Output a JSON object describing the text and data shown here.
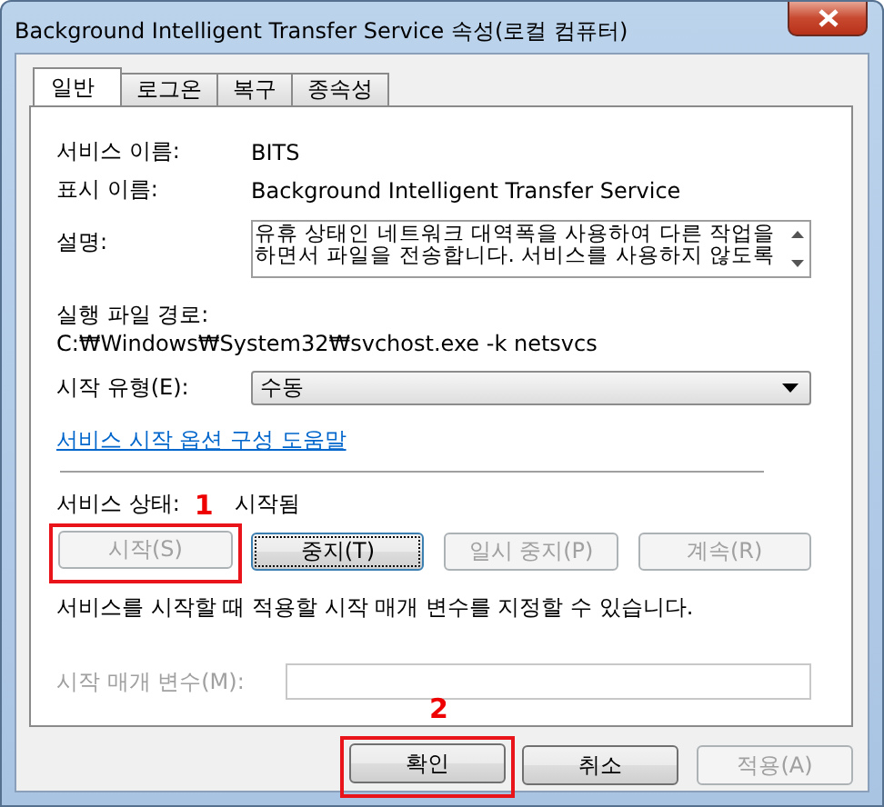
{
  "window": {
    "title": "Background Intelligent Transfer Service 속성(로컬 컴퓨터)"
  },
  "tabs": [
    {
      "label": "일반",
      "selected": true
    },
    {
      "label": "로그온",
      "selected": false
    },
    {
      "label": "복구",
      "selected": false
    },
    {
      "label": "종속성",
      "selected": false
    }
  ],
  "info": [
    {
      "label": "서비스 이름:",
      "value": "BITS"
    },
    {
      "label": "표시 이름:",
      "value": "Background Intelligent Transfer Service"
    }
  ],
  "description": {
    "label": "설명:",
    "lines": [
      "유휴 상태인 네트워크 대역폭을 사용하여 다른 작업을",
      "하면서 파일을 전송합니다. 서비스를 사용하지 않도록"
    ]
  },
  "executable": {
    "label": "실행 파일 경로:",
    "value": "C:₩Windows₩System32₩svchost.exe -k netsvcs"
  },
  "startup_type": {
    "label": "시작 유형(E):",
    "value": "수동"
  },
  "help_link": "서비스 시작 옵션 구성 도움말",
  "status": {
    "label": "서비스 상태:",
    "value": "시작됨"
  },
  "service_buttons": [
    {
      "label": "시작(S)",
      "disabled": true,
      "focused": false,
      "highlighted": true,
      "marker": "1"
    },
    {
      "label": "중지(T)",
      "disabled": false,
      "focused": true,
      "highlighted": false
    },
    {
      "label": "일시 중지(P)",
      "disabled": true,
      "focused": false,
      "highlighted": false
    },
    {
      "label": "계속(R)",
      "disabled": true,
      "focused": false,
      "highlighted": false
    }
  ],
  "hint": "서비스를 시작할 때 적용할 시작 매개 변수를 지정할 수 있습니다.",
  "parameters": {
    "label": "시작 매개 변수(M):",
    "disabled": true
  },
  "dialog_buttons": [
    {
      "label": "확인",
      "disabled": false,
      "highlighted": true,
      "marker": "2"
    },
    {
      "label": "취소",
      "disabled": false,
      "highlighted": false
    },
    {
      "label": "적용(A)",
      "disabled": true,
      "highlighted": false
    }
  ]
}
